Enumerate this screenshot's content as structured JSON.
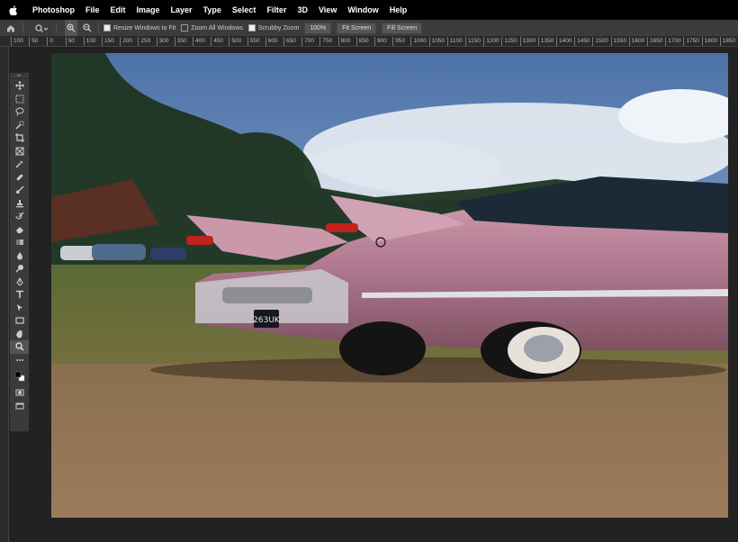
{
  "menubar": {
    "app_name": "Photoshop",
    "items": [
      "File",
      "Edit",
      "Image",
      "Layer",
      "Type",
      "Select",
      "Filter",
      "3D",
      "View",
      "Window",
      "Help"
    ]
  },
  "options_bar": {
    "resize_windows_label": "Resize Windows to Fit",
    "zoom_all_windows_label": "Zoom All Windows",
    "scrubby_zoom_label": "Scrubby Zoom",
    "zoom_level": "100%",
    "fit_screen_label": "Fit Screen",
    "fill_screen_label": "Fill Screen"
  },
  "ruler": {
    "ticks": [
      "100",
      "50",
      "0",
      "50",
      "100",
      "150",
      "200",
      "250",
      "300",
      "350",
      "400",
      "450",
      "500",
      "550",
      "600",
      "650",
      "700",
      "750",
      "800",
      "850",
      "900",
      "950",
      "1000",
      "1050",
      "1100",
      "1150",
      "1200",
      "1250",
      "1300",
      "1350",
      "1400",
      "1450",
      "1500",
      "1550",
      "1600",
      "1650",
      "1700",
      "1750",
      "1800",
      "1850"
    ]
  },
  "tools": [
    "move-icon",
    "marquee-icon",
    "lasso-icon",
    "quick-select-icon",
    "crop-icon",
    "frame-icon",
    "eyedropper-icon",
    "healing-icon",
    "brush-icon",
    "clone-stamp-icon",
    "history-brush-icon",
    "eraser-icon",
    "gradient-icon",
    "blur-icon",
    "dodge-icon",
    "pen-icon",
    "type-icon",
    "path-select-icon",
    "rectangle-icon",
    "hand-icon",
    "zoom-icon",
    "more-icon",
    "color-swatch-icon",
    "quick-mask-icon",
    "screen-mode-icon"
  ],
  "colors": {
    "menubar_bg": "#000000",
    "panel_bg": "#3c3c3c",
    "car_pink": "#c58fa5"
  }
}
